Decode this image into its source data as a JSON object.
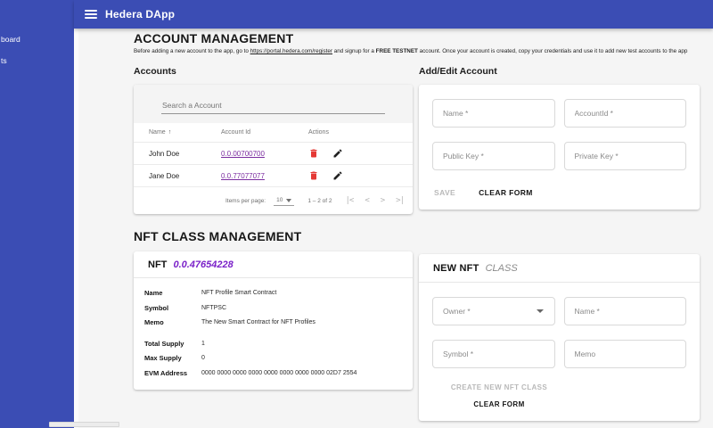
{
  "app": {
    "title": "Hedera DApp"
  },
  "sidebar": {
    "items": [
      {
        "label": "board"
      },
      {
        "label": "ts"
      }
    ]
  },
  "account_management": {
    "title": "ACCOUNT MANAGEMENT",
    "intro": {
      "pre": "Before adding a new account to the app, go to ",
      "link": "https://portal.hedera.com/register",
      "mid": " and signup for a ",
      "emph": "FREE TESTNET",
      "post": " account. Once your account is created, copy your credentials and use it to add new test accounts to the app"
    },
    "accounts": {
      "heading": "Accounts",
      "search_placeholder": "Search a Account",
      "table": {
        "col_name": "Name",
        "col_account_id": "Account Id",
        "col_actions": "Actions",
        "sort_arrow": "↑",
        "rows": [
          {
            "name": "John Doe",
            "account_id": "0.0.00700700"
          },
          {
            "name": "Jane Doe",
            "account_id": "0.0.77077077"
          }
        ]
      },
      "paginator": {
        "items_per_page_label": "Items per page:",
        "page_size": "10",
        "range": "1 – 2 of 2",
        "first": "|<",
        "prev": "<",
        "next": ">",
        "last": ">|"
      }
    },
    "form": {
      "heading": "Add/Edit Account",
      "fields": {
        "name": "Name *",
        "account_id": "AccountId *",
        "public_key": "Public Key *",
        "private_key": "Private Key *"
      },
      "save_label": "SAVE",
      "clear_label": "CLEAR FORM"
    }
  },
  "nft_management": {
    "title": "NFT CLASS MANAGEMENT",
    "details": {
      "heading_prefix": "NFT",
      "heading_id": "0.0.47654228",
      "rows": [
        {
          "label": "Name",
          "value": "NFT Profile Smart Contract"
        },
        {
          "label": "Symbol",
          "value": "NFTPSC"
        },
        {
          "label": "Memo",
          "value": "The New Smart Contract for NFT Profiles"
        },
        {
          "label": "Total Supply",
          "value": "1"
        },
        {
          "label": "Max Supply",
          "value": "0"
        },
        {
          "label": "EVM Address",
          "value": "0000 0000 0000 0000 0000 0000 0000 0000 02D7 2554"
        }
      ]
    },
    "new_form": {
      "heading_bold": "NEW NFT",
      "heading_italic": "CLASS",
      "fields": {
        "owner": "Owner *",
        "name": "Name *",
        "symbol": "Symbol *",
        "memo": "Memo"
      },
      "create_label": "CREATE NEW NFT CLASS",
      "clear_label": "CLEAR FORM"
    }
  },
  "colors": {
    "primary": "#3b4db4",
    "link_purple": "#7b2da0",
    "nft_id_purple": "#7b22c9",
    "delete_red": "#e53935",
    "content_bg": "#f5f5f5"
  }
}
